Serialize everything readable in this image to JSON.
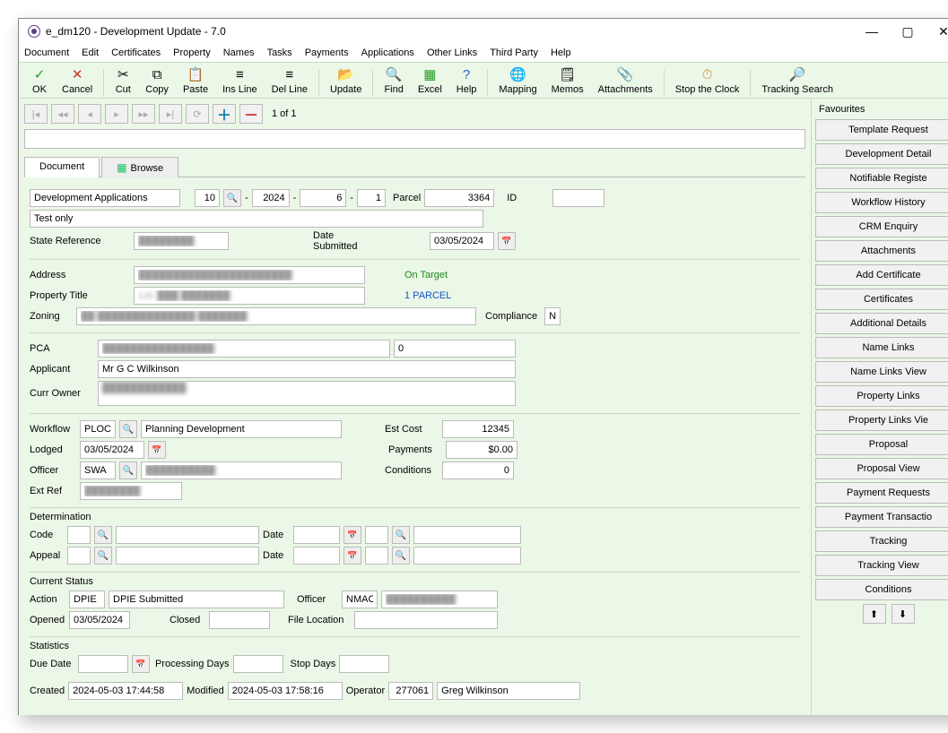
{
  "window": {
    "title": "e_dm120 - Development Update - 7.0"
  },
  "menu": [
    "Document",
    "Edit",
    "Certificates",
    "Property",
    "Names",
    "Tasks",
    "Payments",
    "Applications",
    "Other Links",
    "Third Party",
    "Help"
  ],
  "toolbar": [
    {
      "label": "OK",
      "icon": "✓",
      "cls": "grn"
    },
    {
      "label": "Cancel",
      "icon": "✕",
      "cls": "red2"
    },
    {
      "sep": true
    },
    {
      "label": "Cut",
      "icon": "✂",
      "cls": ""
    },
    {
      "label": "Copy",
      "icon": "⧉",
      "cls": ""
    },
    {
      "label": "Paste",
      "icon": "📋",
      "cls": ""
    },
    {
      "label": "Ins Line",
      "icon": "≡",
      "cls": ""
    },
    {
      "label": "Del Line",
      "icon": "≡",
      "cls": ""
    },
    {
      "sep": true
    },
    {
      "label": "Update",
      "icon": "📂",
      "cls": "ylw"
    },
    {
      "sep": true
    },
    {
      "label": "Find",
      "icon": "🔍",
      "cls": ""
    },
    {
      "label": "Excel",
      "icon": "▦",
      "cls": "grn"
    },
    {
      "label": "Help",
      "icon": "?",
      "cls": "blu2"
    },
    {
      "sep": true
    },
    {
      "label": "Mapping",
      "icon": "🌐",
      "cls": ""
    },
    {
      "label": "Memos",
      "icon": "🗒",
      "cls": ""
    },
    {
      "label": "Attachments",
      "icon": "📎",
      "cls": ""
    },
    {
      "sep": true
    },
    {
      "label": "Stop the Clock",
      "icon": "⏱",
      "cls": "org"
    },
    {
      "sep": true
    },
    {
      "label": "Tracking Search",
      "icon": "🔎",
      "cls": "ylw"
    }
  ],
  "nav": {
    "counter": "1 of 1"
  },
  "tabs": {
    "document": "Document",
    "browse": "Browse"
  },
  "form": {
    "app_type": "Development Applications",
    "seg1": "10",
    "seg2": "2024",
    "seg3": "6",
    "seg4": "1",
    "parcel_lbl": "Parcel",
    "parcel": "3364",
    "id_lbl": "ID",
    "id": "",
    "desc": "Test only",
    "state_ref_lbl": "State Reference",
    "state_ref": "████████",
    "date_sub_lbl": "Date Submitted",
    "date_sub": "03/05/2024",
    "address_lbl": "Address",
    "address": "██████████████████████",
    "on_target": "On Target",
    "prop_title_lbl": "Property Title",
    "prop_title": "Lot: ███ ███████",
    "parcel_link": "1 PARCEL",
    "zoning_lbl": "Zoning",
    "zoning": "██ ██████████████ ███████",
    "compliance_lbl": "Compliance",
    "compliance": "N",
    "pca_lbl": "PCA",
    "pca": "████████████████",
    "pca_num": "0",
    "applicant_lbl": "Applicant",
    "applicant": "Mr G C Wilkinson",
    "curr_owner_lbl": "Curr Owner",
    "curr_owner": "████████████",
    "workflow_lbl": "Workflow",
    "workflow_code": "PLOC",
    "workflow_desc": "Planning Development",
    "est_cost_lbl": "Est Cost",
    "est_cost": "12345",
    "lodged_lbl": "Lodged",
    "lodged": "03/05/2024",
    "payments_lbl": "Payments",
    "payments": "$0.00",
    "officer_lbl": "Officer",
    "officer_code": "SWA",
    "officer_name": "██████████",
    "conditions_lbl": "Conditions",
    "conditions": "0",
    "ext_ref_lbl": "Ext Ref",
    "ext_ref": "████████"
  },
  "det": {
    "hdr": "Determination",
    "code_lbl": "Code",
    "date_lbl": "Date",
    "appeal_lbl": "Appeal"
  },
  "status": {
    "hdr": "Current Status",
    "action_lbl": "Action",
    "action_code": "DPIE",
    "action_desc": "DPIE Submitted",
    "officer_lbl": "Officer",
    "officer_code": "NMAC",
    "officer_name": "██████████",
    "opened_lbl": "Opened",
    "opened": "03/05/2024",
    "closed_lbl": "Closed",
    "closed": "",
    "fileloc_lbl": "File Location",
    "fileloc": ""
  },
  "stats": {
    "hdr": "Statistics",
    "due_lbl": "Due Date",
    "due": "",
    "proc_lbl": "Processing Days",
    "proc": "",
    "stop_lbl": "Stop Days",
    "stop": ""
  },
  "audit": {
    "created_lbl": "Created",
    "created": "2024-05-03 17:44:58",
    "modified_lbl": "Modified",
    "modified": "2024-05-03 17:58:16",
    "operator_lbl": "Operator",
    "op_id": "277061",
    "op_name": "Greg Wilkinson"
  },
  "favourites": {
    "hdr": "Favourites",
    "items": [
      "Template Request",
      "Development Detail",
      "Notifiable Registe",
      "Workflow History",
      "CRM Enquiry",
      "Attachments",
      "Add Certificate",
      "Certificates",
      "Additional Details",
      "Name Links",
      "Name Links View",
      "Property Links",
      "Property Links Vie",
      "Proposal",
      "Proposal View",
      "Payment Requests",
      "Payment Transactio",
      "Tracking",
      "Tracking View",
      "Conditions"
    ]
  }
}
